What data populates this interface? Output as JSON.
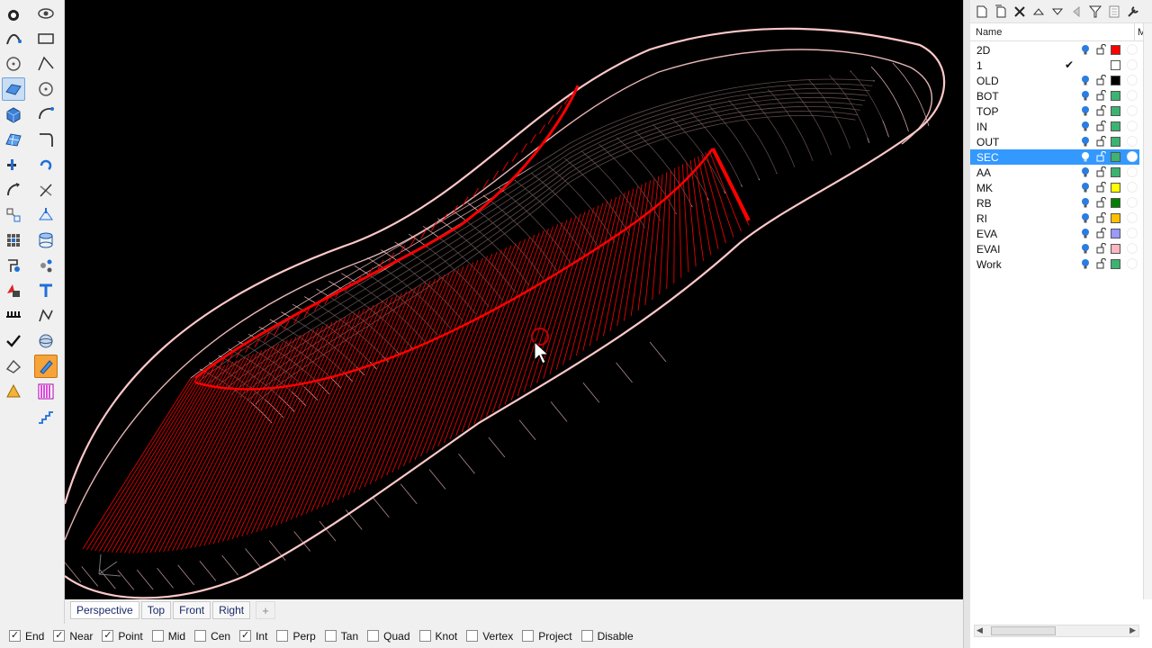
{
  "left_toolbar": {
    "col1": [
      "point-tool-icon",
      "curve-tool-icon",
      "circle-tool-icon",
      "surface-tool-icon",
      "solid-box-icon",
      "mesh-tool-icon",
      "transform-tool-icon",
      "move-tool-icon",
      "dimension-tool-icon",
      "grid-snap-icon",
      "analyze-tool-icon",
      "render-tool-icon",
      "array-tool-icon",
      "checkmark-tool-icon",
      "light-tool-icon",
      "paint-tool-icon"
    ],
    "col2": [
      "view-eye-icon",
      "rectangle-tool-icon",
      "polyline-tool-icon",
      "circle-tool-icon",
      "arc-tool-icon",
      "fillet-tool-icon",
      "rotate-tool-icon",
      "cylinder-tool-icon",
      "group-tool-icon",
      "extrude-tool-icon",
      "text-tool-icon",
      "text-object-icon",
      "curve-edit-icon",
      "sphere-tool-icon",
      "edit-pen-icon",
      "hatch-tool-icon",
      "stairs-tool-icon"
    ]
  },
  "view_tabs": [
    {
      "label": "Perspective",
      "active": true
    },
    {
      "label": "Top",
      "active": false
    },
    {
      "label": "Front",
      "active": false
    },
    {
      "label": "Right",
      "active": false
    }
  ],
  "view_tabs_add": "+",
  "osnaps": [
    {
      "label": "End",
      "checked": true
    },
    {
      "label": "Near",
      "checked": true
    },
    {
      "label": "Point",
      "checked": true
    },
    {
      "label": "Mid",
      "checked": false
    },
    {
      "label": "Cen",
      "checked": false
    },
    {
      "label": "Int",
      "checked": true
    },
    {
      "label": "Perp",
      "checked": false
    },
    {
      "label": "Tan",
      "checked": false
    },
    {
      "label": "Quad",
      "checked": false
    },
    {
      "label": "Knot",
      "checked": false
    },
    {
      "label": "Vertex",
      "checked": false
    },
    {
      "label": "Project",
      "checked": false
    },
    {
      "label": "Disable",
      "checked": false
    }
  ],
  "layer_panel": {
    "header_name": "Name",
    "header_material": "Ma",
    "layers": [
      {
        "name": "2D",
        "color": "#ff0000",
        "current": false,
        "selected": false
      },
      {
        "name": "1",
        "color": "#ffffff",
        "current": true,
        "selected": false
      },
      {
        "name": "OLD",
        "color": "#000000",
        "current": false,
        "selected": false
      },
      {
        "name": "BOT",
        "color": "#3cb371",
        "current": false,
        "selected": false
      },
      {
        "name": "TOP",
        "color": "#3cb371",
        "current": false,
        "selected": false
      },
      {
        "name": "IN",
        "color": "#3cb371",
        "current": false,
        "selected": false
      },
      {
        "name": "OUT",
        "color": "#3cb371",
        "current": false,
        "selected": false
      },
      {
        "name": "SEC",
        "color": "#3cb371",
        "current": false,
        "selected": true
      },
      {
        "name": "AA",
        "color": "#3cb371",
        "current": false,
        "selected": false
      },
      {
        "name": "MK",
        "color": "#ffff00",
        "current": false,
        "selected": false
      },
      {
        "name": "RB",
        "color": "#008000",
        "current": false,
        "selected": false
      },
      {
        "name": "RI",
        "color": "#ffc000",
        "current": false,
        "selected": false
      },
      {
        "name": "EVA",
        "color": "#9999ff",
        "current": false,
        "selected": false
      },
      {
        "name": "EVAI",
        "color": "#ffb6c1",
        "current": false,
        "selected": false
      },
      {
        "name": "Work",
        "color": "#3cb371",
        "current": false,
        "selected": false
      }
    ],
    "check_glyph": "✔",
    "toolbar_icons": [
      "new-layer-icon",
      "new-sublayer-icon",
      "delete-layer-icon",
      "move-up-icon",
      "move-down-icon",
      "previous-icon",
      "filter-icon",
      "layer-states-icon",
      "tools-wrench-icon"
    ]
  },
  "colors": {
    "viewport_bg": "#000000",
    "curve_red": "#ff0000",
    "wire_pink": "#ffc8c8",
    "selection_blue": "#3399ff"
  }
}
